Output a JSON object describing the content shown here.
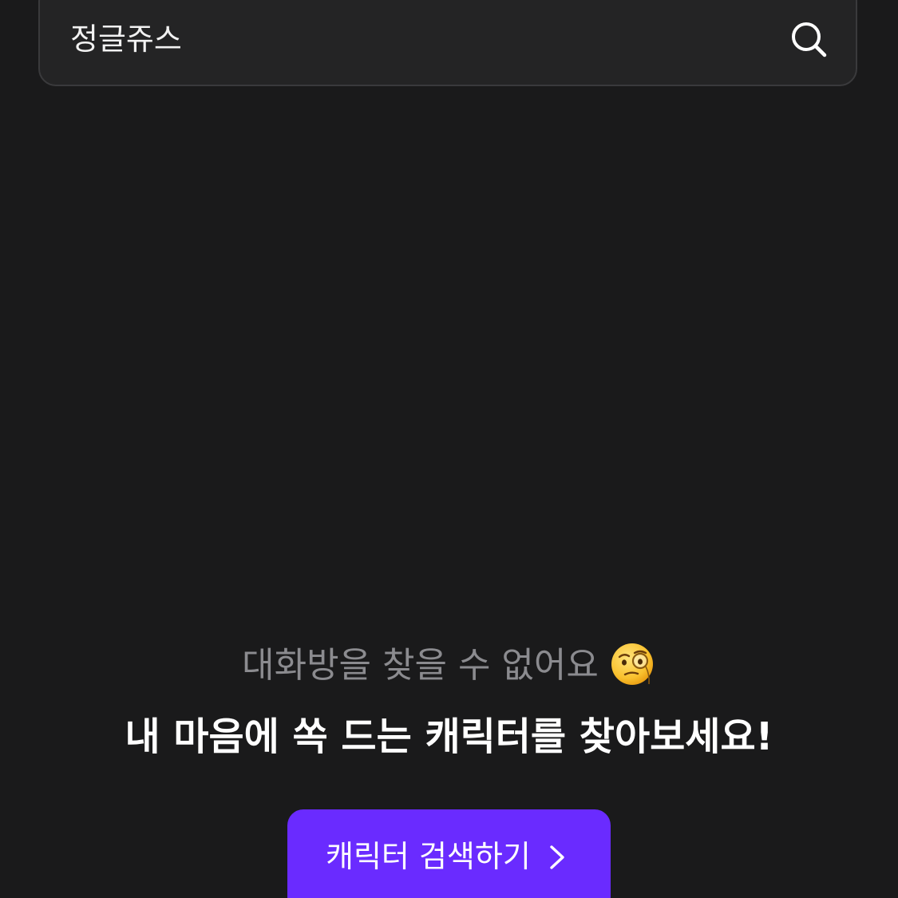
{
  "search": {
    "value": "정글쥬스",
    "icon": "search-icon"
  },
  "empty_state": {
    "title": "대화방을 찾을 수 없어요",
    "emoji_icon": "face-with-monocle-icon",
    "subtitle": "내 마음에 쏙 드는 캐릭터를 찾아보세요!"
  },
  "cta": {
    "label": "캐릭터 검색하기",
    "icon": "chevron-right-icon",
    "color": "#6a2bff"
  },
  "colors": {
    "background": "#1a1a1b",
    "search_bg": "#242425",
    "muted_text": "#8b8b8f"
  }
}
